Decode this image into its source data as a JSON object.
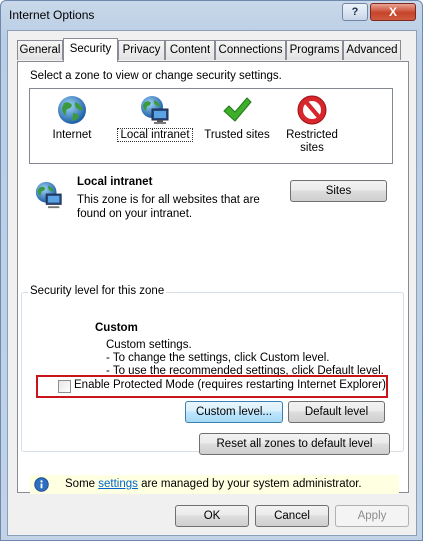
{
  "window": {
    "title": "Internet Options",
    "help_label": "?",
    "close_label": "X"
  },
  "tabs": [
    {
      "label": "General"
    },
    {
      "label": "Security",
      "active": true
    },
    {
      "label": "Privacy"
    },
    {
      "label": "Content"
    },
    {
      "label": "Connections"
    },
    {
      "label": "Programs"
    },
    {
      "label": "Advanced"
    }
  ],
  "security": {
    "zone_prompt": "Select a zone to view or change security settings.",
    "zones": [
      {
        "label": "Internet",
        "icon": "globe-icon"
      },
      {
        "label": "Local intranet",
        "icon": "intranet-icon",
        "selected": true
      },
      {
        "label": "Trusted sites",
        "icon": "checkmark-icon"
      },
      {
        "label": "Restricted sites",
        "icon": "restricted-icon"
      }
    ],
    "zone_info": {
      "title": "Local intranet",
      "description": "This zone is for all websites that are found on your intranet.",
      "sites_button": "Sites"
    },
    "level_group": {
      "title": "Security level for this zone",
      "heading": "Custom",
      "line1": "Custom settings.",
      "line2": "- To change the settings, click Custom level.",
      "line3": "- To use the recommended settings, click Default level."
    },
    "protected_mode": {
      "label": "Enable Protected Mode (requires restarting Internet Explorer)",
      "checked": false
    },
    "custom_level_button": "Custom level...",
    "default_level_button": "Default level",
    "reset_all_button": "Reset all zones to default level",
    "info": {
      "prefix": "Some ",
      "link": "settings",
      "suffix": " are managed by your system administrator."
    }
  },
  "buttons": {
    "ok": "OK",
    "cancel": "Cancel",
    "apply": "Apply"
  },
  "colors": {
    "highlight_border": "#c8151c",
    "info_background": "#ffffe1",
    "link": "#0066cc"
  }
}
